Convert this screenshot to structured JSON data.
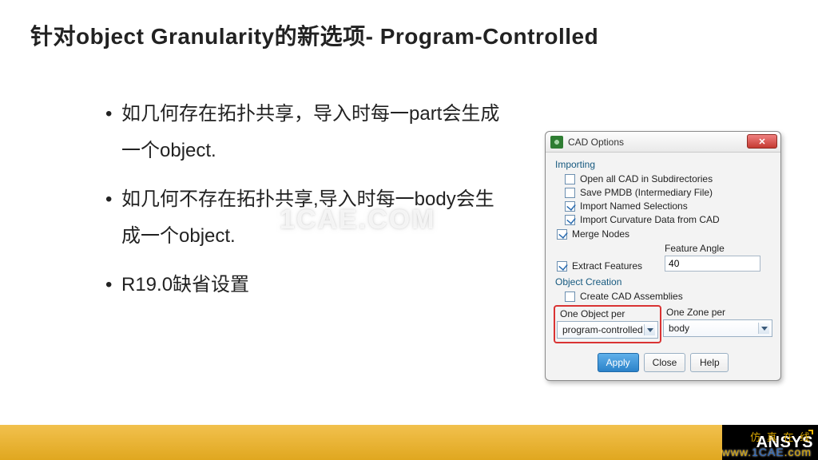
{
  "title": "针对object Granularity的新选项- Program-Controlled",
  "bullets": [
    "如几何存在拓扑共享，导入时每一part会生成一个object.",
    "如几何不存在拓扑共享,导入时每一body会生成一个object.",
    "R19.0缺省设置"
  ],
  "watermark": "1CAE.COM",
  "dialog": {
    "title": "CAD Options",
    "importing_label": "Importing",
    "opts": {
      "open_subdirs": {
        "label": "Open all CAD in Subdirectories",
        "checked": false
      },
      "save_pmdb": {
        "label": "Save PMDB (Intermediary File)",
        "checked": false
      },
      "named_sel": {
        "label": "Import Named Selections",
        "checked": true
      },
      "curv_data": {
        "label": "Import Curvature Data from CAD",
        "checked": true
      }
    },
    "merge_nodes": {
      "label": "Merge Nodes",
      "checked": true
    },
    "extract_features": {
      "label": "Extract Features",
      "checked": true
    },
    "feature_angle_label": "Feature Angle",
    "feature_angle_value": "40",
    "object_creation_label": "Object Creation",
    "create_assemblies": {
      "label": "Create CAD Assemblies",
      "checked": false
    },
    "one_object_per_label": "One Object per",
    "one_object_per_value": "program-controlled",
    "one_zone_per_label": "One Zone per",
    "one_zone_per_value": "body",
    "buttons": {
      "apply": "Apply",
      "close": "Close",
      "help": "Help"
    }
  },
  "footer": {
    "logo": "ANSYS",
    "site_cn": "仿 真 在 线",
    "site_url_prefix": "www.",
    "site_url_domain": "1CAE",
    "site_url_suffix": ".com"
  }
}
